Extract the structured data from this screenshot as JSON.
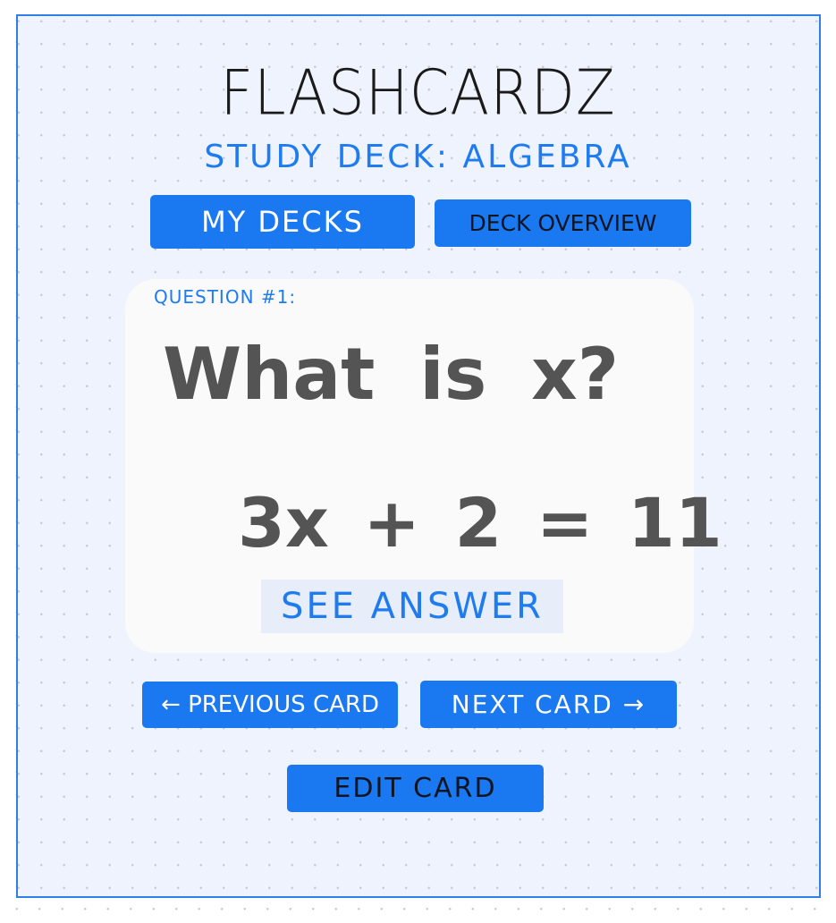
{
  "app": {
    "title": "FLASHCARDZ",
    "subtitle": "STUDY DECK: ALGEBRA"
  },
  "nav": {
    "my_decks": "MY DECKS",
    "deck_overview": "DECK OVERVIEW"
  },
  "card": {
    "label": "QUESTION #1:",
    "question": "What is x?",
    "equation": "3x + 2 = 11",
    "see_answer": "SEE ANSWER"
  },
  "controls": {
    "previous": "← PREVIOUS CARD",
    "next": "NEXT CARD →",
    "edit": "EDIT CARD"
  },
  "colors": {
    "accent": "#1a78f0",
    "frame_border": "#2f7fe6",
    "frame_bg": "#eef3fd",
    "card_bg": "#fafafa",
    "ink_gray": "#545454"
  }
}
